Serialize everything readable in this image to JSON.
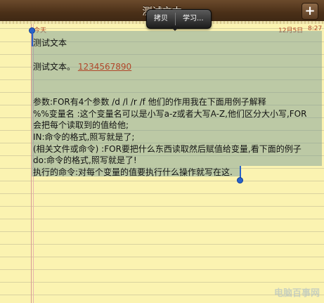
{
  "titlebar": {
    "title": "测试文本",
    "add_label": "+"
  },
  "date": {
    "today": "今天",
    "date": "12月5日",
    "time": "8:27"
  },
  "popover": {
    "copy": "拷贝",
    "learn": "学习..."
  },
  "note": {
    "line1": "测试文本",
    "line2_text": "测试文本。",
    "line2_link": "1234567890",
    "line3": "参数:FOR有4个参数 /d   /l   /r   /f   他们的作用我在下面用例子解释",
    "line4": "%%变量名 :这个变量名可以是小写a-z或者大写A-Z,他们区分大小写,FOR",
    "line5": "会把每个读取到的值给他;",
    "line6": "IN:命令的格式,照写就是了;",
    "line7": "(相关文件或命令) :FOR要把什么东西读取然后赋值给变量,看下面的例子",
    "line8": "do:命令的格式,照写就是了!",
    "line9": "执行的命令:对每个变量的值要执行什么操作就写在这."
  },
  "watermark": "电脑百事网",
  "colors": {
    "selection": "#6e9696",
    "handle": "#2a62c8",
    "accent": "#b0472a"
  }
}
